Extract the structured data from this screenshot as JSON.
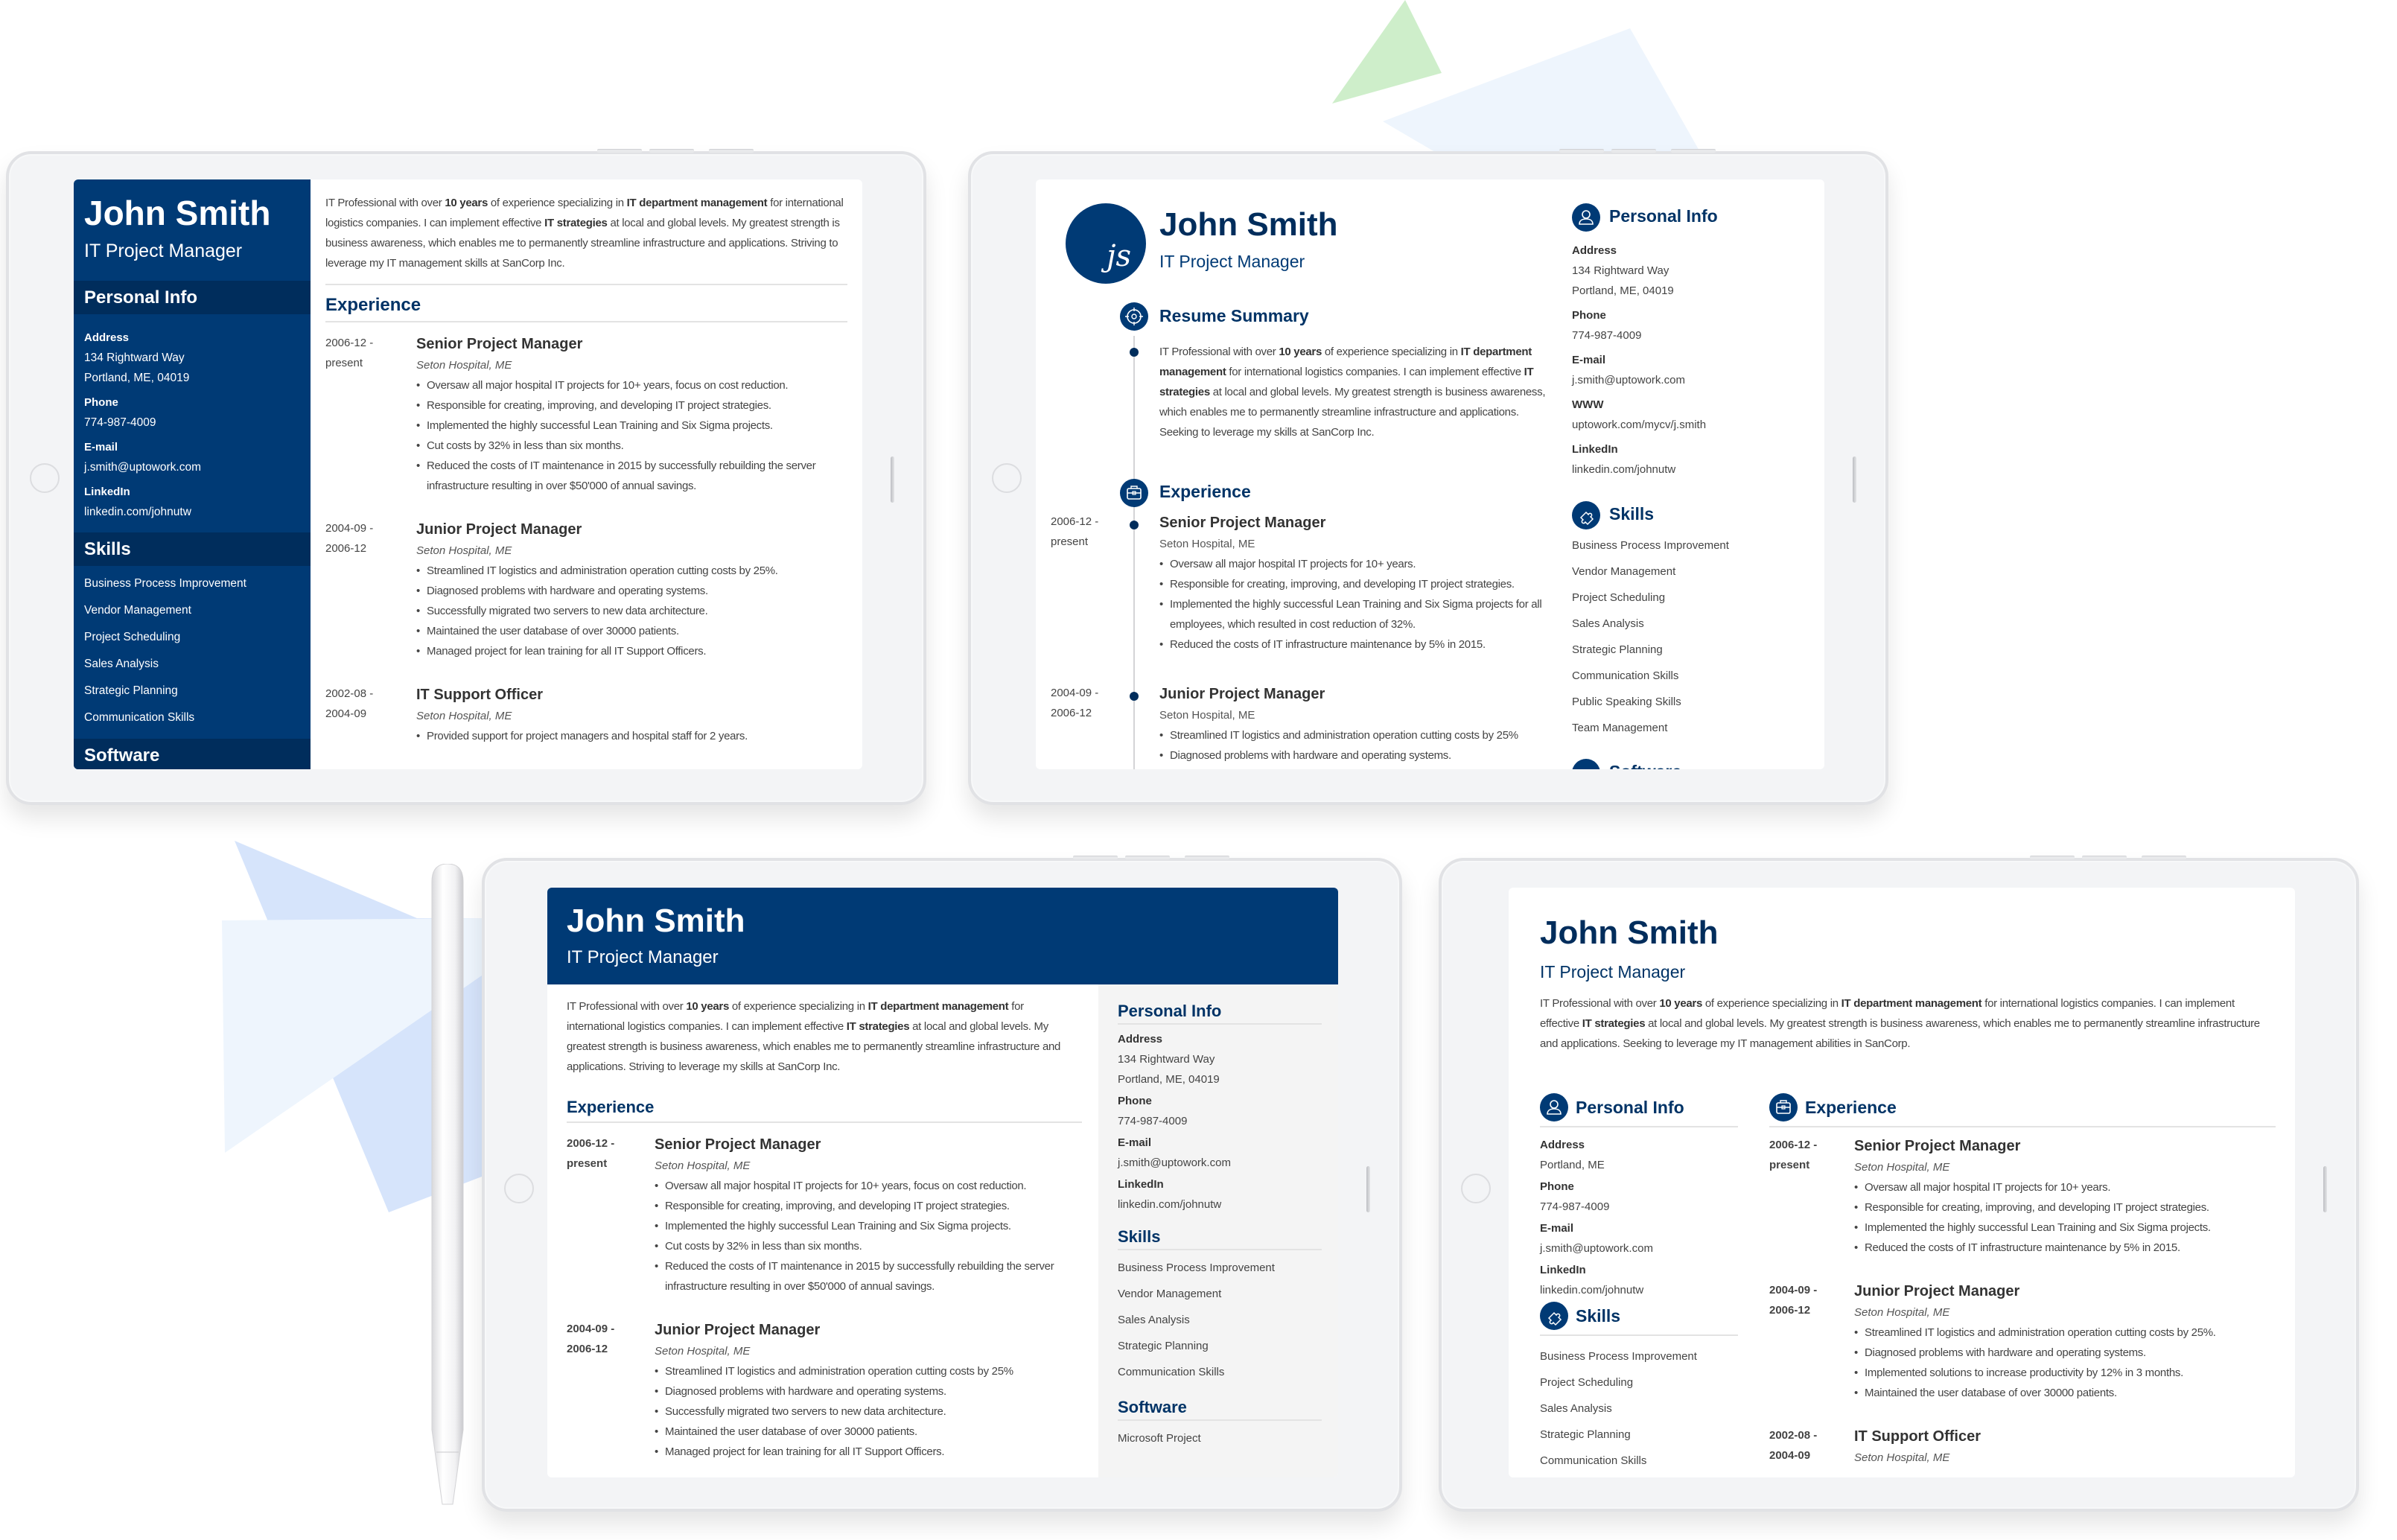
{
  "colors": {
    "primary_navy": "#003a75",
    "section_navy": "#002d5c",
    "heading_navy": "#003366",
    "tablet_frame": "#f3f4f6",
    "sidebar_gray": "#f4f4f4",
    "deco_blue": "#d6e4fb",
    "deco_light_blue": "#eef5fd",
    "deco_green": "#c9ecc4"
  },
  "person": {
    "name": "John Smith",
    "role": "IT Project Manager",
    "initials": "js"
  },
  "resume1": {
    "summary": {
      "t1": "IT Professional with over ",
      "b1": "10 years",
      "t2": " of experience specializing in ",
      "b2": "IT department management",
      "t3": " for international logistics companies. I can implement effective ",
      "b3": "IT strategies",
      "t4": " at local and global levels. My greatest strength is business awareness, which enables me to permanently streamline infrastructure and applications. Striving to leverage my IT management skills at SanCorp Inc."
    },
    "sections": {
      "personal": "Personal Info",
      "skills": "Skills",
      "software": "Software",
      "experience": "Experience"
    },
    "personal": [
      {
        "label": "Address",
        "lines": [
          "134 Rightward Way",
          "Portland, ME, 04019"
        ]
      },
      {
        "label": "Phone",
        "lines": [
          "774-987-4009"
        ]
      },
      {
        "label": "E-mail",
        "lines": [
          "j.smith@uptowork.com"
        ]
      },
      {
        "label": "LinkedIn",
        "lines": [
          "linkedin.com/johnutw"
        ]
      }
    ],
    "skills": [
      "Business Process Improvement",
      "Vendor Management",
      "Project Scheduling",
      "Sales Analysis",
      "Strategic Planning",
      "Communication Skills"
    ],
    "jobs": [
      {
        "date1": "2006-12 -",
        "date2": "present",
        "title": "Senior Project Manager",
        "company": "Seton Hospital, ME",
        "bullets": [
          "Oversaw all major hospital IT projects for 10+ years, focus on cost reduction.",
          "Responsible for creating, improving, and developing IT project strategies.",
          "Implemented the highly successful Lean Training and Six Sigma projects.",
          "Cut costs by 32% in less than six months.",
          "Reduced the costs of IT maintenance in 2015 by successfully rebuilding the server infrastructure resulting in over $50'000 of annual savings."
        ]
      },
      {
        "date1": "2004-09 -",
        "date2": "2006-12",
        "title": "Junior Project Manager",
        "company": "Seton Hospital, ME",
        "bullets": [
          "Streamlined IT logistics and administration operation cutting costs by 25%.",
          "Diagnosed problems with hardware and operating systems.",
          "Successfully migrated two servers to new data architecture.",
          "Maintained the user database of over 30000 patients.",
          "Managed project for lean training for all IT Support Officers."
        ]
      },
      {
        "date1": "2002-08 -",
        "date2": "2004-09",
        "title": "IT Support Officer",
        "company": "Seton Hospital, ME",
        "bullets": [
          "Provided support for project managers and hospital staff for 2 years."
        ]
      }
    ]
  },
  "resume2": {
    "sections": {
      "summary": "Resume Summary",
      "experience": "Experience",
      "personal": "Personal Info",
      "skills": "Skills",
      "software": "Software"
    },
    "summary": {
      "t1": "IT Professional with over ",
      "b1": "10 years",
      "t2": " of experience specializing in ",
      "b2": "IT department management",
      "t3": " for international logistics companies. I can implement effective ",
      "b3": "IT strategies",
      "t4": " at local and global levels. My greatest strength is business awareness, which enables me to permanently streamline infrastructure and applications. Seeking to leverage my skills at SanCorp Inc."
    },
    "personal": [
      {
        "label": "Address",
        "lines": [
          "134 Rightward Way",
          "Portland, ME, 04019"
        ]
      },
      {
        "label": "Phone",
        "lines": [
          "774-987-4009"
        ]
      },
      {
        "label": "E-mail",
        "lines": [
          "j.smith@uptowork.com"
        ]
      },
      {
        "label": "WWW",
        "lines": [
          "uptowork.com/mycv/j.smith"
        ]
      },
      {
        "label": "LinkedIn",
        "lines": [
          "linkedin.com/johnutw"
        ]
      }
    ],
    "skills": [
      "Business Process Improvement",
      "Vendor Management",
      "Project Scheduling",
      "Sales Analysis",
      "Strategic Planning",
      "Communication Skills",
      "Public Speaking Skills",
      "Team Management"
    ],
    "jobs": [
      {
        "date1": "2006-12 -",
        "date2": "present",
        "title": "Senior Project Manager",
        "company": "Seton Hospital, ME",
        "bullets": [
          "Oversaw all major hospital IT projects for 10+ years.",
          "Responsible for creating, improving, and developing IT project strategies.",
          "Implemented the highly successful Lean Training and Six Sigma projects for all employees, which resulted in cost reduction of 32%.",
          "Reduced the costs of IT infrastructure maintenance by 5% in 2015."
        ]
      },
      {
        "date1": "2004-09 -",
        "date2": "2006-12",
        "title": "Junior Project Manager",
        "company": "Seton Hospital, ME",
        "bullets": [
          "Streamlined IT logistics and administration operation cutting costs by 25%",
          "Diagnosed problems with hardware and operating systems."
        ]
      }
    ]
  },
  "resume3": {
    "sections": {
      "experience": "Experience",
      "personal": "Personal Info",
      "skills": "Skills",
      "software": "Software"
    },
    "summary": {
      "t1": "IT Professional with over ",
      "b1": "10 years",
      "t2": " of experience specializing in ",
      "b2": "IT department management",
      "t3": " for international logistics companies. I can implement effective ",
      "b3": "IT strategies",
      "t4": " at local and global levels. My greatest strength is business awareness, which enables me to permanently streamline infrastructure and applications. Striving to leverage my skills at SanCorp Inc."
    },
    "personal": [
      {
        "label": "Address",
        "lines": [
          "134 Rightward Way",
          "Portland, ME, 04019"
        ]
      },
      {
        "label": "Phone",
        "lines": [
          "774-987-4009"
        ]
      },
      {
        "label": "E-mail",
        "lines": [
          "j.smith@uptowork.com"
        ]
      },
      {
        "label": "LinkedIn",
        "lines": [
          "linkedin.com/johnutw"
        ]
      }
    ],
    "skills": [
      "Business Process Improvement",
      "Vendor Management",
      "Sales Analysis",
      "Strategic Planning",
      "Communication Skills"
    ],
    "software": [
      "Microsoft Project"
    ],
    "jobs": [
      {
        "date1": "2006-12 -",
        "date2": "present",
        "title": "Senior Project Manager",
        "company": "Seton Hospital, ME",
        "bullets": [
          "Oversaw all major hospital IT projects for 10+ years, focus on cost reduction.",
          "Responsible for creating, improving, and developing IT project strategies.",
          "Implemented the highly successful Lean Training and Six Sigma projects.",
          "Cut costs by 32% in less than six months.",
          "Reduced the costs of IT maintenance in 2015 by successfully rebuilding the server infrastructure resulting in over $50'000 of annual savings."
        ]
      },
      {
        "date1": "2004-09 -",
        "date2": "2006-12",
        "title": "Junior Project Manager",
        "company": "Seton Hospital, ME",
        "bullets": [
          "Streamlined IT logistics and administration operation cutting costs by 25%",
          "Diagnosed problems with hardware and operating systems.",
          "Successfully migrated two servers to new data architecture.",
          "Maintained the user database of over 30000 patients.",
          "Managed project for lean training for all IT Support Officers."
        ]
      }
    ]
  },
  "resume4": {
    "sections": {
      "experience": "Experience",
      "personal": "Personal Info",
      "skills": "Skills"
    },
    "summary": {
      "t1": "IT Professional with over ",
      "b1": "10 years",
      "t2": " of experience specializing in ",
      "b2": "IT department management",
      "t3": " for international logistics companies. I can implement effective ",
      "b3": "IT strategies",
      "t4": " at local and global levels. My greatest strength is business awareness, which enables me to permanently streamline infrastructure and applications. Seeking to leverage my IT management abilities in SanCorp."
    },
    "personal": [
      {
        "label": "Address",
        "lines": [
          "Portland, ME"
        ]
      },
      {
        "label": "Phone",
        "lines": [
          "774-987-4009"
        ]
      },
      {
        "label": "E-mail",
        "lines": [
          "j.smith@uptowork.com"
        ]
      },
      {
        "label": "LinkedIn",
        "lines": [
          "linkedin.com/johnutw"
        ]
      }
    ],
    "skills": [
      "Business Process Improvement",
      "Project Scheduling",
      "Sales Analysis",
      "Strategic Planning",
      "Communication Skills"
    ],
    "jobs": [
      {
        "date1": "2006-12 -",
        "date2": "present",
        "title": "Senior Project Manager",
        "company": "Seton Hospital, ME",
        "bullets": [
          "Oversaw all major hospital IT projects for 10+ years.",
          "Responsible for creating, improving, and developing IT project strategies.",
          "Implemented the highly successful Lean Training and Six Sigma projects.",
          "Reduced the costs of IT infrastructure maintenance by 5% in 2015."
        ]
      },
      {
        "date1": "2004-09 -",
        "date2": "2006-12",
        "title": "Junior Project Manager",
        "company": "Seton Hospital, ME",
        "bullets": [
          "Streamlined IT logistics and administration operation cutting costs by 25%.",
          "Diagnosed problems with hardware and operating systems.",
          "Implemented solutions to increase productivity by 12% in 3 months.",
          "Maintained the user database of over 30000 patients."
        ]
      },
      {
        "date1": "2002-08 -",
        "date2": "2004-09",
        "title": "IT Support Officer",
        "company": "Seton Hospital, ME",
        "bullets": []
      }
    ]
  }
}
